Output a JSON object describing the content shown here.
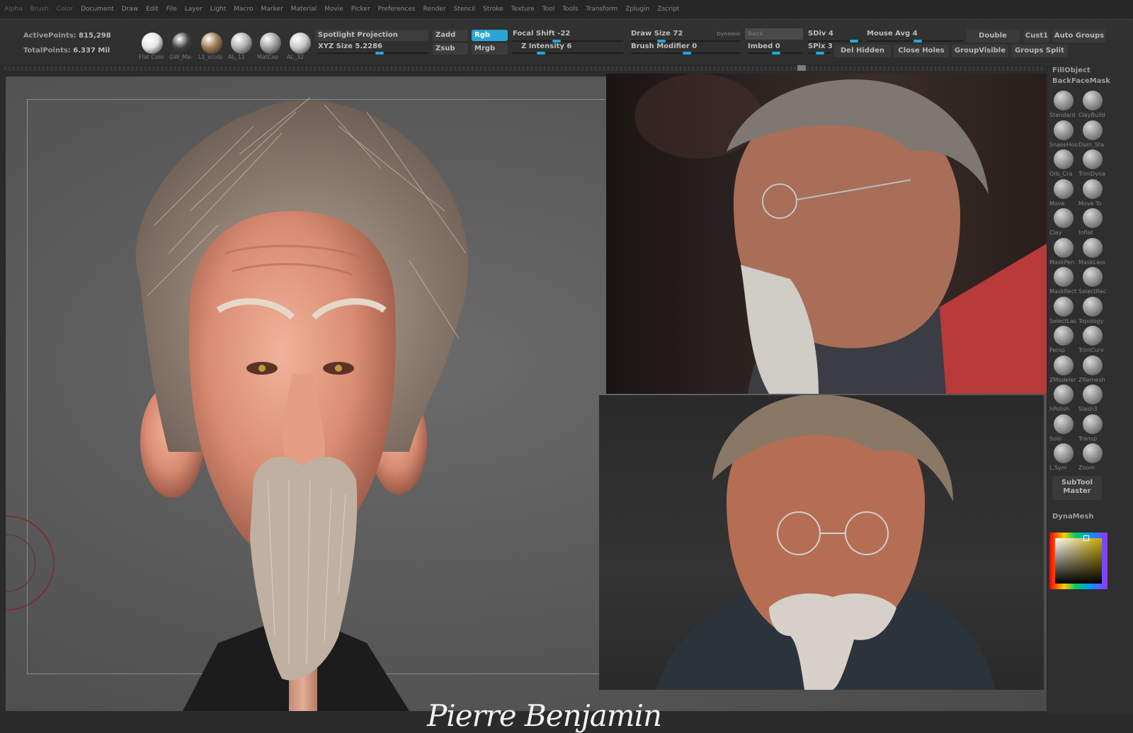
{
  "menu": [
    "Alpha",
    "Brush",
    "Color",
    "Document",
    "Draw",
    "Edit",
    "File",
    "Layer",
    "Light",
    "Macro",
    "Marker",
    "Material",
    "Movie",
    "Picker",
    "Preferences",
    "Render",
    "Stencil",
    "Stroke",
    "Texture",
    "Tool",
    "Tools",
    "Transform",
    "Zplugin",
    "Zscript"
  ],
  "stats": {
    "active_label": "ActivePoints:",
    "active_value": "815,298",
    "total_label": "TotalPoints:",
    "total_value": "6.337 Mil"
  },
  "materials": [
    {
      "label": "Flat Colo",
      "color": "#e6e6e6"
    },
    {
      "label": "GW_Ma:",
      "color": "#3e3e3e"
    },
    {
      "label": "L1_sculp",
      "color": "#a07a52"
    },
    {
      "label": "AL_11",
      "color": "#b0b0b0"
    },
    {
      "label": "MatCap",
      "color": "#a0a0a0"
    },
    {
      "label": "AL_32",
      "color": "#c8c8c8"
    }
  ],
  "controls": {
    "spotlight": "Spotlight Projection",
    "xyz_size": "XYZ Size 5.2286",
    "zadd": "Zadd",
    "zsub": "Zsub",
    "rgb": "Rgb",
    "mrgb": "Mrgb",
    "focal_shift": "Focal Shift -22",
    "z_intensity": "Z Intensity 6",
    "draw_size": "Draw Size 72",
    "dynamic": "Dynamic",
    "brush_modifier": "Brush Modifier 0",
    "back": "Back",
    "imbed": "Imbed 0",
    "sdiv": "SDiv 4",
    "spix": "SPix 3",
    "mouse_avg": "Mouse Avg 4",
    "double": "Double",
    "custom": "Cust1",
    "auto_groups": "Auto Groups",
    "del_hidden": "Del Hidden",
    "close_holes": "Close Holes",
    "group_visible": "GroupVisible",
    "groups_split": "Groups Split"
  },
  "palette": {
    "fill_object": "FillObject",
    "backface_mask": "BackFaceMask",
    "brushes": [
      "Standard",
      "ClayBuild",
      "SnakeHoo",
      "Dam_Sta",
      "Orb_Cra",
      "TrimDyna",
      "Move",
      "Move To",
      "Clay",
      "Inflat",
      "MaskPen",
      "MaskLass",
      "MaskRect",
      "SelectRec",
      "SelectLas",
      "Topology",
      "Persp",
      "TrimCurv",
      "ZModeler",
      "ZRemesh",
      "hPolish",
      "Slash3",
      "Solo",
      "Transp",
      "L.Sym",
      "Zoom"
    ],
    "subtool_master": "SubTool Master",
    "dynamesh": "DynaMesh"
  },
  "signature": "Pierre Benjamin",
  "colors": {
    "accent": "#2aa6d6",
    "background": "#2b2b2b",
    "canvas": "#5c5c5c"
  }
}
